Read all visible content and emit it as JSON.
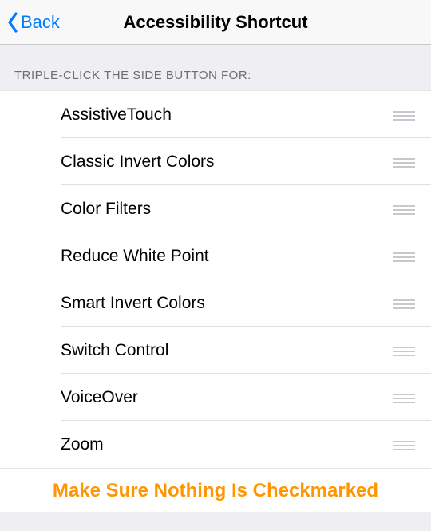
{
  "nav": {
    "back_label": "Back",
    "title": "Accessibility Shortcut"
  },
  "section": {
    "header": "TRIPLE-CLICK THE SIDE BUTTON FOR:"
  },
  "items": [
    {
      "label": "AssistiveTouch"
    },
    {
      "label": "Classic Invert Colors"
    },
    {
      "label": "Color Filters"
    },
    {
      "label": "Reduce White Point"
    },
    {
      "label": "Smart Invert Colors"
    },
    {
      "label": "Switch Control"
    },
    {
      "label": "VoiceOver"
    },
    {
      "label": "Zoom"
    }
  ],
  "banner": {
    "text": "Make Sure Nothing Is Checkmarked"
  }
}
